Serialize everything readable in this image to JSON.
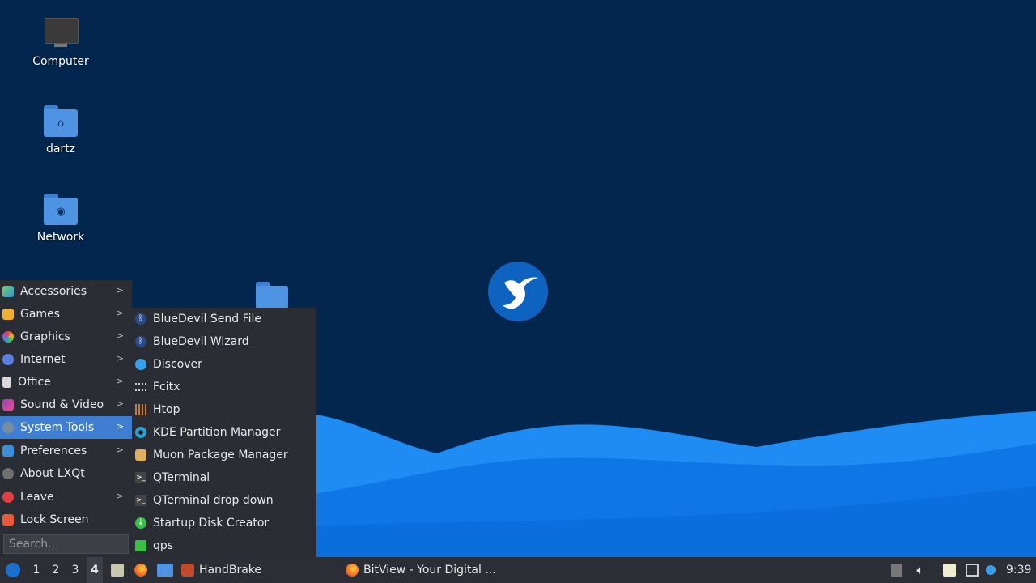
{
  "desktop": {
    "icons": [
      {
        "label": "Computer",
        "icon": "computer-icon"
      },
      {
        "label": "dartz",
        "icon": "home-folder-icon"
      },
      {
        "label": "Network",
        "icon": "network-folder-icon"
      }
    ]
  },
  "menu": {
    "items": [
      {
        "label": "Accessories",
        "icon": "accessories-icon",
        "has_submenu": true
      },
      {
        "label": "Games",
        "icon": "games-icon",
        "has_submenu": true
      },
      {
        "label": "Graphics",
        "icon": "graphics-icon",
        "has_submenu": true
      },
      {
        "label": "Internet",
        "icon": "internet-icon",
        "has_submenu": true
      },
      {
        "label": "Office",
        "icon": "office-icon",
        "has_submenu": true
      },
      {
        "label": "Sound & Video",
        "icon": "sound-video-icon",
        "has_submenu": true
      },
      {
        "label": "System Tools",
        "icon": "system-tools-icon",
        "has_submenu": true,
        "active": true
      },
      {
        "label": "Preferences",
        "icon": "preferences-icon",
        "has_submenu": true
      },
      {
        "label": "About LXQt",
        "icon": "about-icon",
        "has_submenu": false
      },
      {
        "label": "Leave",
        "icon": "leave-icon",
        "has_submenu": true
      },
      {
        "label": "Lock Screen",
        "icon": "lock-icon",
        "has_submenu": false
      }
    ],
    "search_placeholder": "Search..."
  },
  "submenu": {
    "items": [
      {
        "label": "BlueDevil Send File",
        "icon": "bluetooth-icon"
      },
      {
        "label": "BlueDevil Wizard",
        "icon": "bluetooth-icon"
      },
      {
        "label": "Discover",
        "icon": "discover-icon"
      },
      {
        "label": "Fcitx",
        "icon": "keyboard-icon"
      },
      {
        "label": "Htop",
        "icon": "htop-icon"
      },
      {
        "label": "KDE Partition Manager",
        "icon": "partition-icon"
      },
      {
        "label": "Muon Package Manager",
        "icon": "package-icon"
      },
      {
        "label": "QTerminal",
        "icon": "terminal-icon"
      },
      {
        "label": "QTerminal drop down",
        "icon": "terminal-icon"
      },
      {
        "label": "Startup Disk Creator",
        "icon": "startup-disk-icon"
      },
      {
        "label": "qps",
        "icon": "qps-icon"
      }
    ]
  },
  "taskbar": {
    "desktops": [
      "1",
      "2",
      "3",
      "4"
    ],
    "active_desktop": "4",
    "windows": [
      {
        "label": "HandBrake",
        "icon": "handbrake-icon"
      },
      {
        "label": "BitView - Your Digital ...",
        "icon": "firefox-icon"
      }
    ],
    "clock": "9:39"
  },
  "colors": {
    "wallpaper_dark": "#03264f",
    "wave_light": "#1e8cf3",
    "wave_mid": "#0a6fdd",
    "menu_bg": "#2a2d34",
    "menu_active": "#3f7fd2",
    "taskbar_bg": "#2b2e35"
  }
}
